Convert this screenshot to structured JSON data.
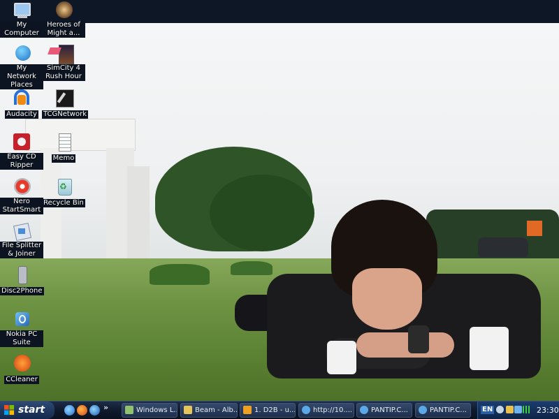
{
  "desktop": {
    "icons": [
      {
        "label": "My Computer",
        "icon": "my-computer-icon"
      },
      {
        "label": "My Network Places",
        "icon": "network-places-icon"
      },
      {
        "label": "Audacity",
        "icon": "audacity-icon"
      },
      {
        "label": "Easy CD Ripper",
        "icon": "cd-ripper-icon"
      },
      {
        "label": "Nero StartSmart",
        "icon": "nero-icon"
      },
      {
        "label": "File Splitter & Joiner",
        "icon": "file-splitter-icon"
      },
      {
        "label": "Disc2Phone",
        "icon": "phone-icon"
      },
      {
        "label": "Nokia PC Suite",
        "icon": "nokia-icon"
      },
      {
        "label": "CCleaner",
        "icon": "ccleaner-icon"
      },
      {
        "label": "Heroes of Might a...",
        "icon": "heroes-icon"
      },
      {
        "label": "SimCity 4 Rush Hour",
        "icon": "simcity-icon"
      },
      {
        "label": "TCGNetwork",
        "icon": "tcg-icon"
      },
      {
        "label": "Memo",
        "icon": "memo-icon"
      },
      {
        "label": "Recycle Bin",
        "icon": "recycle-bin-icon"
      }
    ]
  },
  "taskbar": {
    "start_label": "start",
    "quick_launch_more": "»",
    "tasks": [
      {
        "label": "Windows L..."
      },
      {
        "label": "Beam - Alb..."
      },
      {
        "label": "1. D2B - u..."
      },
      {
        "label": "http://10...."
      },
      {
        "label": "PANTIP.C..."
      },
      {
        "label": "PANTIP.C..."
      }
    ],
    "tray": {
      "language": "EN",
      "clock": "23:30"
    }
  }
}
